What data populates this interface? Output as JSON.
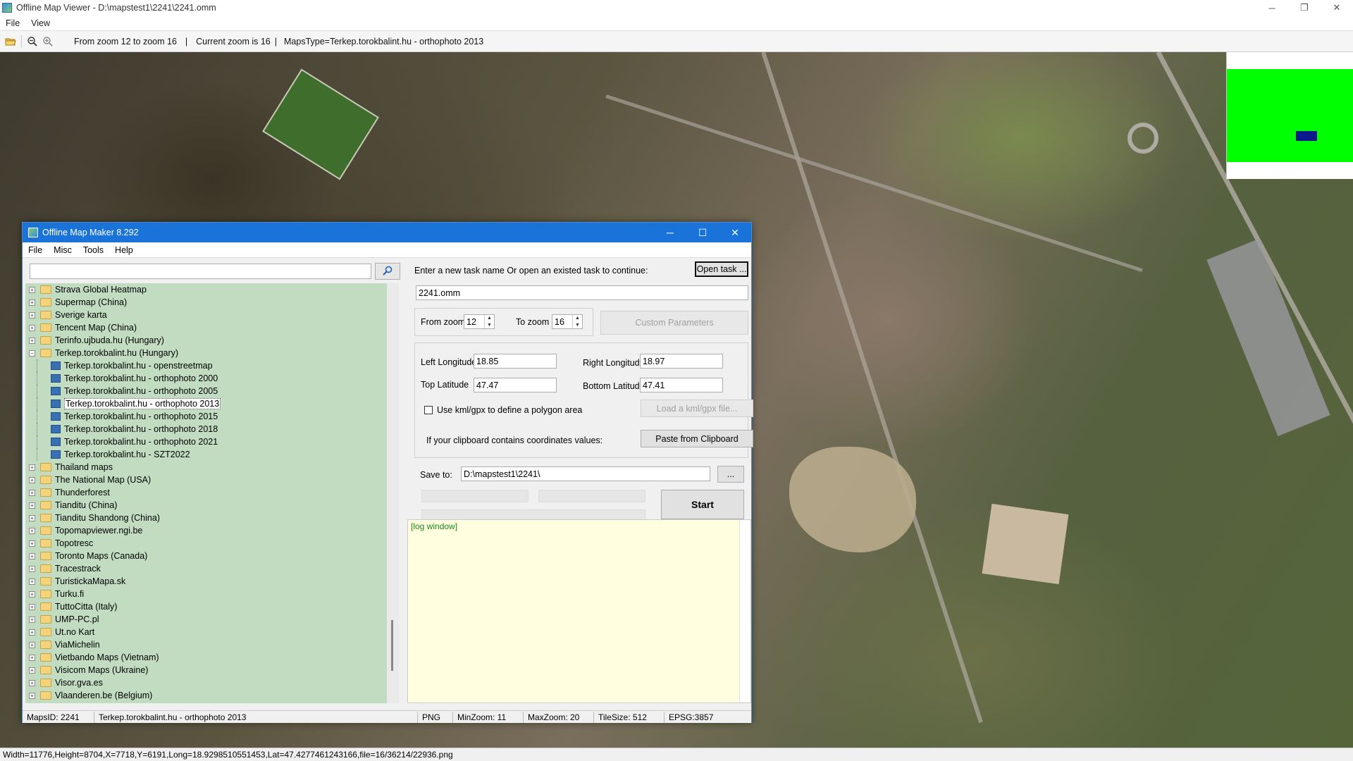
{
  "window": {
    "title": "Offline Map Viewer - D:\\mapstest1\\2241\\2241.omm",
    "minimize_glyph": "─",
    "restore_glyph": "❐",
    "close_glyph": "✕"
  },
  "menu": {
    "file": "File",
    "view": "View"
  },
  "toolbar": {
    "icons": [
      "open-folder-icon",
      "zoom-out-icon",
      "zoom-in-icon"
    ],
    "zoom_range": "From zoom 12 to zoom 16",
    "sep1": "|",
    "current_zoom": "Current zoom is 16",
    "sep2": "|",
    "maps_type": "MapsType=Terkep.torokbalint.hu - orthophoto 2013"
  },
  "status_bar": "Width=11776,Height=8704,X=7718,Y=6191,Long=18.9298510551453,Lat=47.4277461243166,file=16/36214/22936.png",
  "dialog": {
    "title": "Offline Map Maker 8.292",
    "menu": {
      "file": "File",
      "misc": "Misc",
      "tools": "Tools",
      "help": "Help"
    },
    "search": {
      "value": "",
      "placeholder": ""
    },
    "tree": [
      {
        "label": "Strava Global Heatmap",
        "type": "folder",
        "expanded": false
      },
      {
        "label": "Supermap (China)",
        "type": "folder",
        "expanded": false
      },
      {
        "label": "Sverige karta",
        "type": "folder",
        "expanded": false
      },
      {
        "label": "Tencent Map (China)",
        "type": "folder",
        "expanded": false
      },
      {
        "label": "Terinfo.ujbuda.hu (Hungary)",
        "type": "folder",
        "expanded": false
      },
      {
        "label": "Terkep.torokbalint.hu (Hungary)",
        "type": "folder",
        "expanded": true
      },
      {
        "label": "Terkep.torokbalint.hu - openstreetmap",
        "type": "map"
      },
      {
        "label": "Terkep.torokbalint.hu - orthophoto 2000",
        "type": "map"
      },
      {
        "label": "Terkep.torokbalint.hu - orthophoto 2005",
        "type": "map"
      },
      {
        "label": "Terkep.torokbalint.hu - orthophoto 2013",
        "type": "map",
        "selected": true
      },
      {
        "label": "Terkep.torokbalint.hu - orthophoto 2015",
        "type": "map"
      },
      {
        "label": "Terkep.torokbalint.hu - orthophoto 2018",
        "type": "map"
      },
      {
        "label": "Terkep.torokbalint.hu - orthophoto 2021",
        "type": "map"
      },
      {
        "label": "Terkep.torokbalint.hu - SZT2022",
        "type": "map"
      },
      {
        "label": "Thailand maps",
        "type": "folder"
      },
      {
        "label": "The National Map (USA)",
        "type": "folder"
      },
      {
        "label": "Thunderforest",
        "type": "folder"
      },
      {
        "label": "Tianditu (China)",
        "type": "folder"
      },
      {
        "label": "Tianditu Shandong (China)",
        "type": "folder"
      },
      {
        "label": "Topomapviewer.ngi.be",
        "type": "folder"
      },
      {
        "label": "Topotresc",
        "type": "folder"
      },
      {
        "label": "Toronto Maps (Canada)",
        "type": "folder"
      },
      {
        "label": "Tracestrack",
        "type": "folder"
      },
      {
        "label": "TuristickaMapa.sk",
        "type": "folder"
      },
      {
        "label": "Turku.fi",
        "type": "folder"
      },
      {
        "label": "TuttoCitta (Italy)",
        "type": "folder"
      },
      {
        "label": "UMP-PC.pl",
        "type": "folder"
      },
      {
        "label": "Ut.no Kart",
        "type": "folder"
      },
      {
        "label": "ViaMichelin",
        "type": "folder"
      },
      {
        "label": "Vietbando Maps (Vietnam)",
        "type": "folder"
      },
      {
        "label": "Visicom Maps (Ukraine)",
        "type": "folder"
      },
      {
        "label": "Visor.gva.es",
        "type": "folder"
      },
      {
        "label": "Vlaanderen.be (Belgium)",
        "type": "folder"
      }
    ],
    "task": {
      "prompt": "Enter a new task name Or open an existed task to continue:",
      "open_button": "Open task ...",
      "name": "2241.omm"
    },
    "zoom": {
      "from_label": "From zoom",
      "from_value": "12",
      "to_label": "To zoom",
      "to_value": "16",
      "custom_button": "Custom Parameters"
    },
    "coords": {
      "left_lon_label": "Left Longitude",
      "left_lon": "18.85",
      "right_lon_label": "Right Longitude",
      "right_lon": "18.97",
      "top_lat_label": "Top Latitude",
      "top_lat": "47.47",
      "bottom_lat_label": "Bottom Latitude",
      "bottom_lat": "47.41",
      "kml_checkbox_label": "Use kml/gpx to define a polygon area",
      "kml_checked": false,
      "load_kml_button": "Load a kml/gpx file...",
      "clipboard_text": "If your clipboard contains coordinates values:",
      "paste_button": "Paste from Clipboard"
    },
    "save": {
      "label": "Save to:",
      "path": "D:\\mapstest1\\2241\\",
      "browse_button": "..."
    },
    "start_button": "Start",
    "log_text": "[log window]",
    "status": {
      "maps_id": "MapsID: 2241",
      "map_name": "Terkep.torokbalint.hu - orthophoto 2013",
      "format": "PNG",
      "min_zoom": "MinZoom: 11",
      "max_zoom": "MaxZoom: 20",
      "tile_size": "TileSize: 512",
      "epsg": "EPSG:3857"
    }
  },
  "colors": {
    "dialog_title": "#1a73d9",
    "tree_bg": "#c1dcc1",
    "log_bg": "#ffffe0",
    "minimap_green": "#00ff00"
  }
}
